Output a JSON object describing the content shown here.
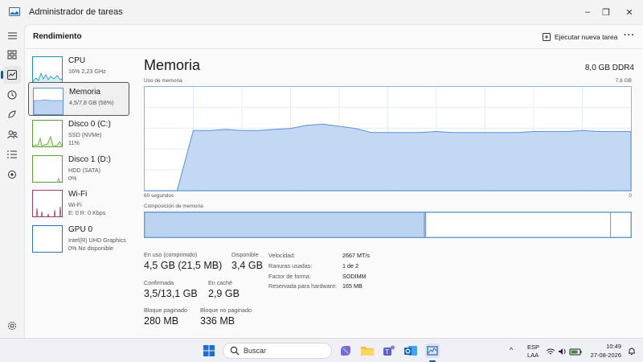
{
  "window": {
    "title": "Administrador de tareas",
    "buttons": {
      "minimize": "–",
      "maximize": "❐",
      "close": "✕"
    }
  },
  "nav": {
    "items": [
      {
        "name": "menu-icon",
        "glyph": "☰"
      },
      {
        "name": "processes-icon",
        "glyph": "▦"
      },
      {
        "name": "performance-icon",
        "glyph": "◫"
      },
      {
        "name": "app-history-icon",
        "glyph": "↺"
      },
      {
        "name": "startup-apps-icon",
        "glyph": "⌁"
      },
      {
        "name": "users-icon",
        "glyph": "👥"
      },
      {
        "name": "details-icon",
        "glyph": "≣"
      },
      {
        "name": "services-icon",
        "glyph": "⚙"
      }
    ],
    "settings_glyph": "⚙"
  },
  "header": {
    "title": "Rendimiento",
    "run_task": "Ejecutar nueva tarea",
    "more": "···"
  },
  "devices": [
    {
      "name": "CPU",
      "sub1": "16% 2,23 GHz",
      "sub2": "",
      "color": "#1a8fbf"
    },
    {
      "name": "Memoria",
      "sub1": "4,5/7,8 GB (58%)",
      "sub2": "",
      "color": "#5e8fd6"
    },
    {
      "name": "Disco 0 (C:)",
      "sub1": "SSD (NVMe)",
      "sub2": "11%",
      "color": "#5da132"
    },
    {
      "name": "Disco 1 (D:)",
      "sub1": "HDD (SATA)",
      "sub2": "0%",
      "color": "#5da132"
    },
    {
      "name": "Wi-Fi",
      "sub1": "Wi-Fi",
      "sub2": "E: 0 R: 0 Kbps",
      "color": "#a73a6e"
    },
    {
      "name": "GPU 0",
      "sub1": "Intel(R) UHD Graphics",
      "sub2": "0% No disponible",
      "color": "#2f6fbf"
    }
  ],
  "memory": {
    "title": "Memoria",
    "spec": "8,0 GB DDR4",
    "usage_label": "Uso de memoria",
    "usage_max": "7,8 GB",
    "time_left": "60 segundos",
    "time_right": "0",
    "composition_label": "Composición de memoria",
    "usage_series": [
      0,
      0,
      0,
      0.58,
      0.58,
      0.59,
      0.58,
      0.58,
      0.59,
      0.6,
      0.63,
      0.64,
      0.62,
      0.6,
      0.56,
      0.56,
      0.56,
      0.56,
      0.57,
      0.56,
      0.56,
      0.56,
      0.56,
      0.56,
      0.57,
      0.57,
      0.57,
      0.58,
      0.57,
      0.57,
      0.57
    ],
    "composition": {
      "in_use": 0.575,
      "modified": 0.003,
      "standby": 0.38,
      "free": 0.042
    }
  },
  "stats": {
    "in_use_label": "En uso (comprimido)",
    "in_use_value": "4,5 GB (21,5 MB)",
    "available_label": "Disponible",
    "available_value": "3,4 GB",
    "committed_label": "Confirmada",
    "committed_value": "3,5/13,1 GB",
    "cached_label": "En caché",
    "cached_value": "2,9 GB",
    "paged_label": "Bloque paginado",
    "paged_value": "280 MB",
    "nonpaged_label": "Bloque no paginado",
    "nonpaged_value": "336 MB"
  },
  "hardware": {
    "speed_label": "Velocidad:",
    "speed_value": "2667 MT/s",
    "slots_label": "Ranuras usadas:",
    "slots_value": "1 de 2",
    "form_label": "Factor de forma:",
    "form_value": "SODIMM",
    "reserved_label": "Reservada para hardware:",
    "reserved_value": "165 MB"
  },
  "taskbar": {
    "search_placeholder": "Buscar",
    "lang1": "ESP",
    "lang2": "LAA",
    "time": "10:49",
    "date": "27-08-2026"
  }
}
